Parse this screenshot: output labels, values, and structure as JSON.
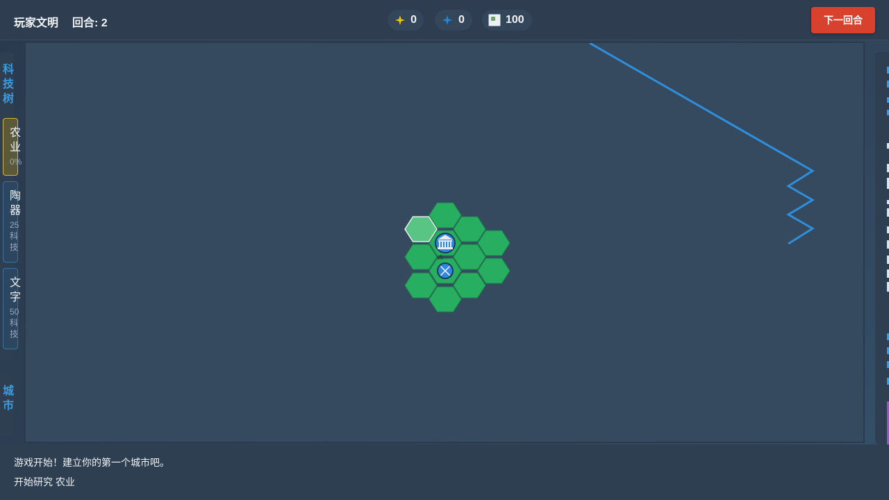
{
  "topbar": {
    "civ_name": "玩家文明",
    "turn_label": "回合: 2",
    "resources": [
      {
        "name": "gold",
        "icon": "gold-star-icon",
        "color": "#f1c40f",
        "value": "0"
      },
      {
        "name": "science",
        "icon": "science-star-icon",
        "color": "#1e88e5",
        "value": "0"
      },
      {
        "name": "food",
        "icon": "broken-image-icon",
        "value": "100"
      }
    ],
    "next_turn_label": "下一回合"
  },
  "tech_panel": {
    "title": "科技树",
    "items": [
      {
        "name": "农业",
        "cost": "0%",
        "active": true
      },
      {
        "name": "陶器",
        "cost": "25科技",
        "active": false
      },
      {
        "name": "文字",
        "cost": "50科技",
        "active": false
      }
    ]
  },
  "city_panel": {
    "title": "城市"
  },
  "map": {
    "city_icon": "city-building-icon",
    "unit_icon": "warrior-unit-icon",
    "tile_color": "#27ae60",
    "selected_tile_color": "#58c585",
    "path_color": "#2e8fdc"
  },
  "log": {
    "lines": [
      "游戏开始！建立你的第一个城市吧。",
      "开始研究 农业"
    ]
  },
  "colors": {
    "accent": "#3a9be0",
    "next_turn": "#d9412f",
    "active_tech_border": "#d4b532"
  }
}
